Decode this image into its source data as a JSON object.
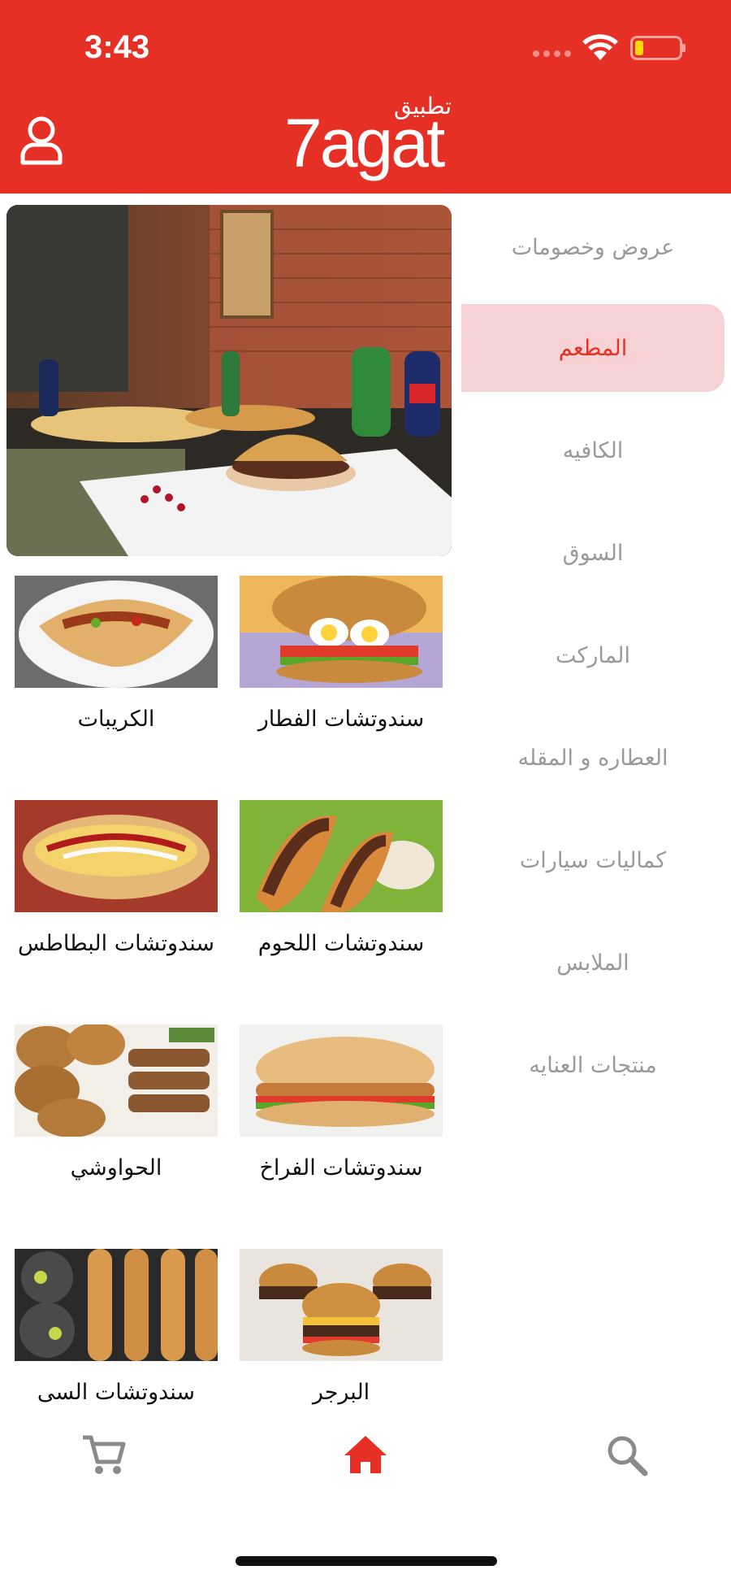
{
  "status_bar": {
    "time": "3:43"
  },
  "app": {
    "logo_main": "7agat",
    "logo_arabic": "تطبيق"
  },
  "sidebar": {
    "items": [
      {
        "label": "عروض وخصومات",
        "active": false
      },
      {
        "label": "المطعم",
        "active": true
      },
      {
        "label": "الكافيه",
        "active": false
      },
      {
        "label": "السوق",
        "active": false
      },
      {
        "label": "الماركت",
        "active": false
      },
      {
        "label": "العطاره و المقله",
        "active": false
      },
      {
        "label": "كماليات سيارات",
        "active": false
      },
      {
        "label": "الملابس",
        "active": false
      },
      {
        "label": "منتجات العنايه",
        "active": false
      }
    ]
  },
  "categories": [
    {
      "label": "الكريبات"
    },
    {
      "label": "سندوتشات الفطار"
    },
    {
      "label": "سندوتشات البطاطس"
    },
    {
      "label": "سندوتشات اللحوم"
    },
    {
      "label": "الحواوشي"
    },
    {
      "label": "سندوتشات الفراخ"
    },
    {
      "label": "سندوتشات السى"
    },
    {
      "label": "البرجر"
    }
  ],
  "colors": {
    "brand_red": "#e63025",
    "active_bg": "#f7d2d4",
    "inactive_text": "#9a9a9a"
  },
  "bottom_nav": {
    "icons": [
      "cart-icon",
      "home-icon",
      "search-icon"
    ],
    "active": "home-icon"
  }
}
